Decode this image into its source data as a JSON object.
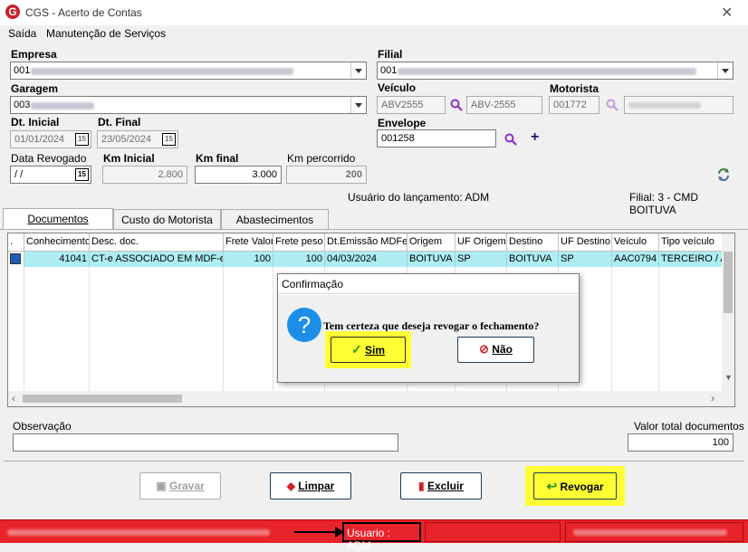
{
  "window": {
    "title": "CGS - Acerto de Contas",
    "close": "✕"
  },
  "menu": {
    "items": [
      "Saída",
      "Manutenção de Serviços"
    ]
  },
  "form": {
    "empresa": {
      "label": "Empresa",
      "value": "001"
    },
    "filial": {
      "label": "Filial",
      "value": "001"
    },
    "garagem": {
      "label": "Garagem",
      "value": "003"
    },
    "veiculo": {
      "label": "Veículo",
      "code": "ABV2555",
      "desc": "ABV-2555"
    },
    "motorista": {
      "label": "Motorista",
      "code": "001772"
    },
    "dt_inicial": {
      "label": "Dt. Inicial",
      "value": "01/01/2024"
    },
    "dt_final": {
      "label": "Dt. Final",
      "value": "23/05/2024"
    },
    "envelope": {
      "label": "Envelope",
      "value": "001258"
    },
    "data_revogado": {
      "label": "Data Revogado",
      "value": " / /"
    },
    "km_inicial": {
      "label": "Km Inicial",
      "value": "2.800"
    },
    "km_final": {
      "label": "Km final",
      "value": "3.000"
    },
    "km_percorrido": {
      "label": "Km percorrido",
      "value": "200"
    },
    "calendar_glyph": "15",
    "usuario_lancamento": "Usuário do lançamento: ADM",
    "filial_info": "Filial: 3 - CMD BOITUVA"
  },
  "tabs": [
    "Documentos",
    "Custo do Motorista",
    "Abastecimentos"
  ],
  "grid": {
    "headers": [
      ".",
      "Conhecimento",
      "Desc. doc.",
      "Frete Valor",
      "Frete peso",
      "Dt.Emissão MDFe",
      "Origem",
      "UF Origem",
      "Destino",
      "UF Destino",
      "Veículo",
      "Tipo veículo"
    ],
    "row": [
      "",
      "41041",
      "CT-e ASSOCIADO EM MDF-e",
      "100",
      "100",
      "04/03/2024",
      "BOITUVA",
      "SP",
      "BOITUVA",
      "SP",
      "AAC0794",
      "TERCEIRO / A"
    ]
  },
  "observacao": {
    "label": "Observação",
    "value": ""
  },
  "valor_total": {
    "label": "Valor total documentos",
    "value": "100"
  },
  "buttons": {
    "gravar": "Gravar",
    "limpar": "Limpar",
    "excluir": "Excluir",
    "revogar": "Revogar"
  },
  "dialog": {
    "title": "Confirmação",
    "message": "Tem certeza que deseja revogar o fechamento?",
    "icon": "?",
    "yes": "Sim",
    "no": "Não"
  },
  "status": {
    "usuario": "Usuario : ADM"
  },
  "colors": {
    "accent_highlight": "#ffff33",
    "row_selected": "#aeeef2",
    "status_bar": "#e8232a",
    "search_icon": "#8b2fc9"
  }
}
